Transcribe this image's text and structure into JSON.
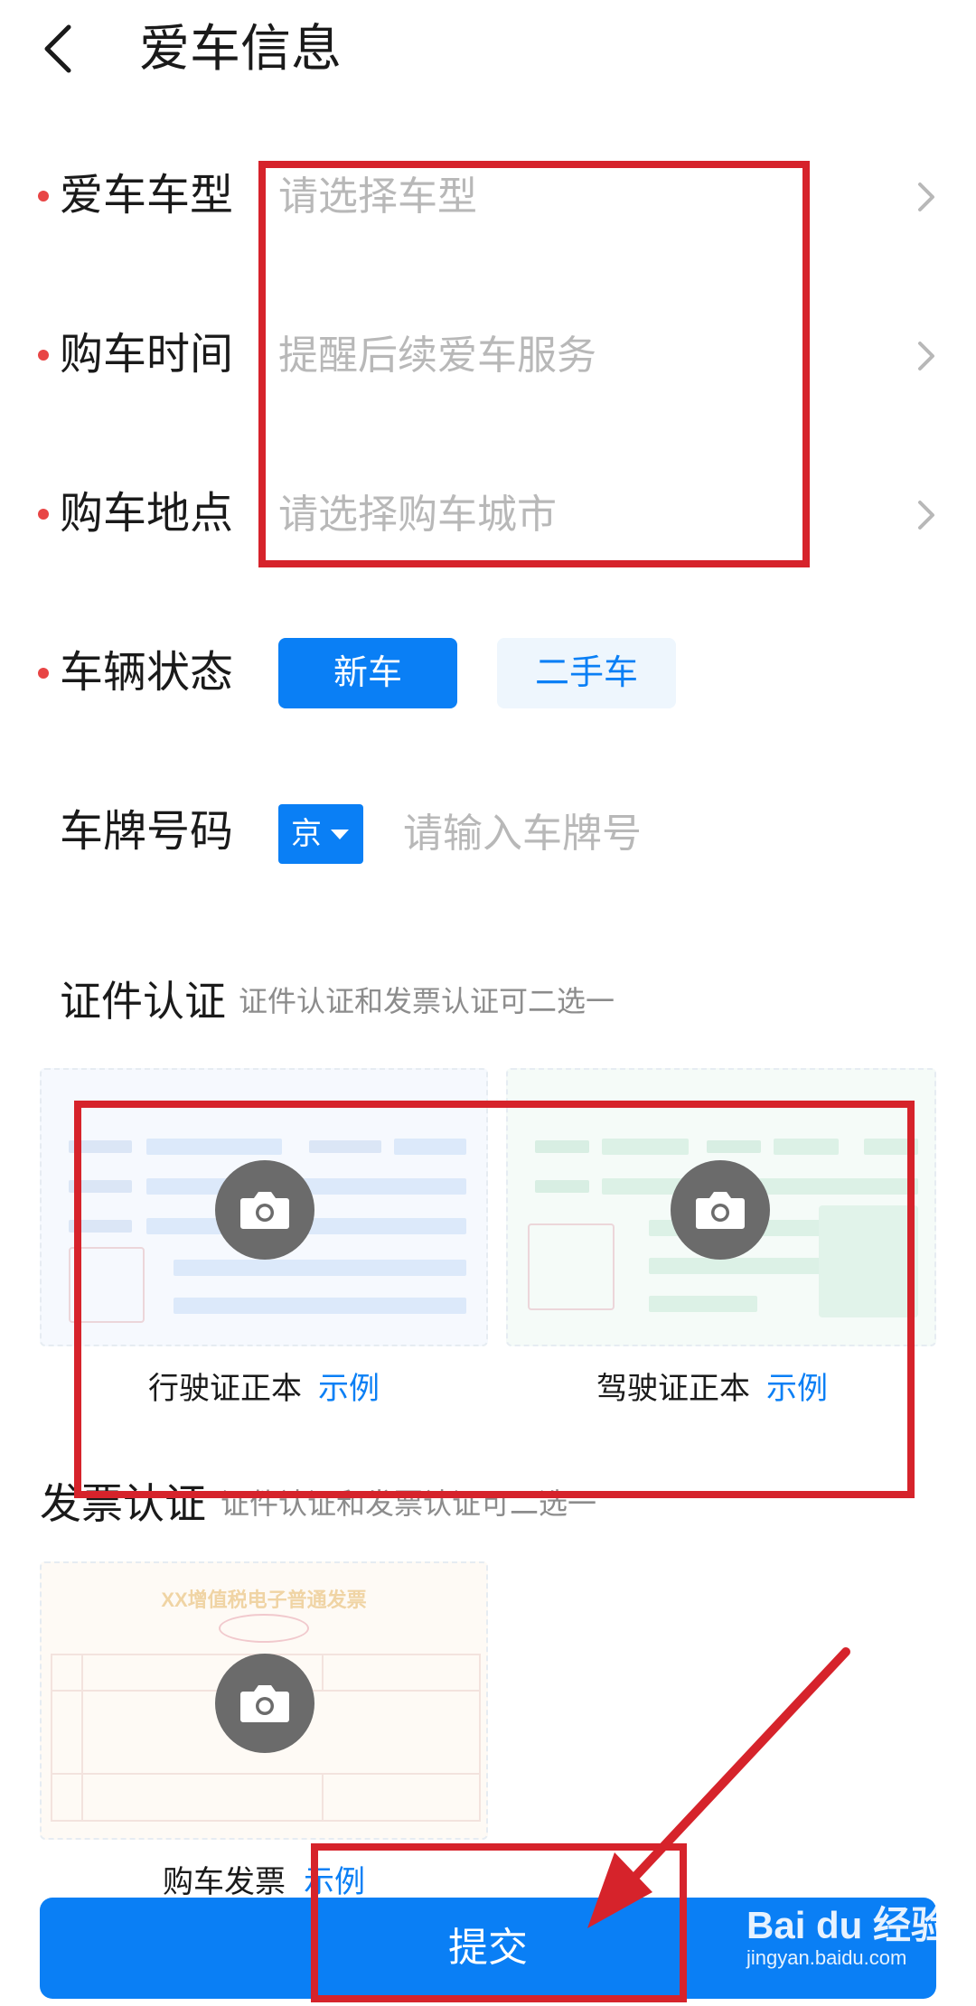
{
  "header": {
    "title": "爱车信息"
  },
  "form": {
    "model": {
      "label": "爱车车型",
      "placeholder": "请选择车型"
    },
    "purchase_time": {
      "label": "购车时间",
      "placeholder": "提醒后续爱车服务"
    },
    "purchase_place": {
      "label": "购车地点",
      "placeholder": "请选择购车城市"
    },
    "vehicle_status": {
      "label": "车辆状态",
      "options": [
        "新车",
        "二手车"
      ],
      "selected": "新车"
    },
    "plate": {
      "label": "车牌号码",
      "province": "京",
      "placeholder": "请输入车牌号"
    }
  },
  "certification": {
    "title": "证件认证",
    "subtitle": "证件认证和发票认证可二选一",
    "cards": [
      {
        "caption": "行驶证正本",
        "link": "示例"
      },
      {
        "caption": "驾驶证正本",
        "link": "示例"
      }
    ]
  },
  "invoice": {
    "title": "发票认证",
    "subtitle": "证件认证和发票认证可二选一",
    "card_title": "XX增值税电子普通发票",
    "caption": "购车发票",
    "link": "示例"
  },
  "submit_label": "提交",
  "watermark": {
    "brand": "Bai du 经验",
    "url": "jingyan.baidu.com"
  },
  "colors": {
    "accent": "#0a7ff5",
    "required_dot": "#e84545",
    "placeholder": "#b8b8b8",
    "annotation_red": "#d6232b"
  }
}
